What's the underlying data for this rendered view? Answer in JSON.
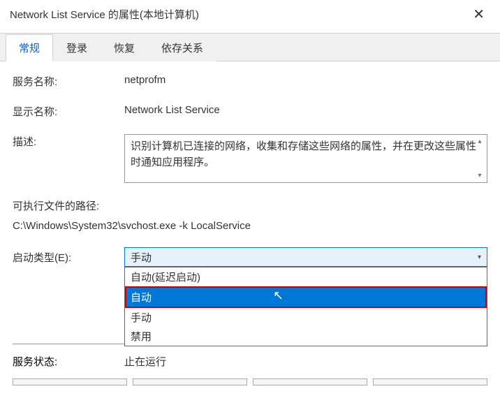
{
  "title": "Network List Service 的属性(本地计算机)",
  "tabs": [
    {
      "label": "常规"
    },
    {
      "label": "登录"
    },
    {
      "label": "恢复"
    },
    {
      "label": "依存关系"
    }
  ],
  "fields": {
    "service_name_label": "服务名称:",
    "service_name_value": "netprofm",
    "display_name_label": "显示名称:",
    "display_name_value": "Network List Service",
    "description_label": "描述:",
    "description_value": "识别计算机已连接的网络，收集和存储这些网络的属性，并在更改这些属性时通知应用程序。",
    "path_label": "可执行文件的路径:",
    "path_value": "C:\\Windows\\System32\\svchost.exe -k LocalService",
    "startup_label": "启动类型(E):",
    "startup_selected": "手动",
    "startup_options": [
      "自动(延迟启动)",
      "自动",
      "手动",
      "禁用"
    ],
    "status_label": "服务状态:",
    "status_value": "止在运行"
  }
}
